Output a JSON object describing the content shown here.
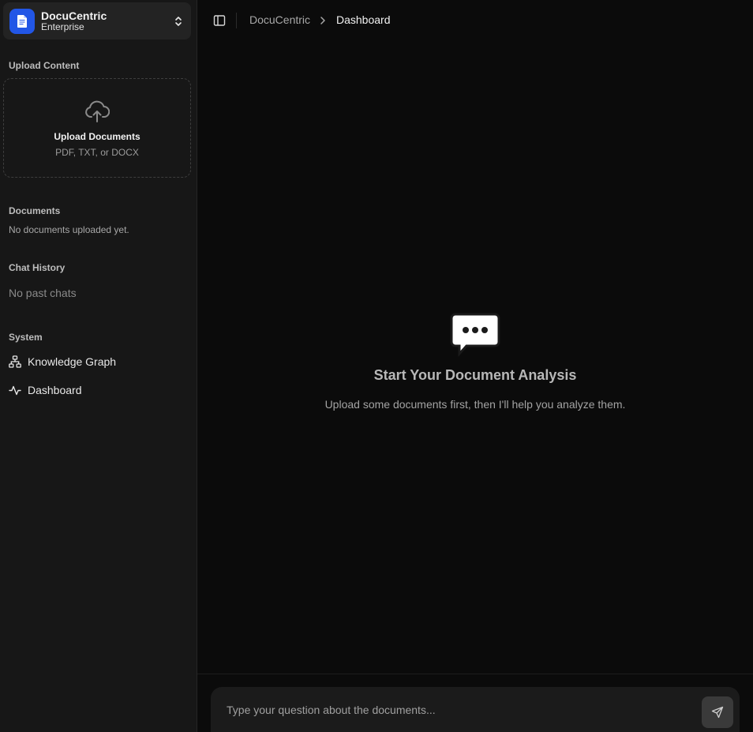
{
  "workspace": {
    "title": "DocuCentric",
    "subtitle": "Enterprise"
  },
  "upload": {
    "section_label": "Upload Content",
    "title": "Upload Documents",
    "subtitle": "PDF, TXT, or DOCX"
  },
  "documents": {
    "section_label": "Documents",
    "empty_text": "No documents uploaded yet."
  },
  "chat_history": {
    "section_label": "Chat History",
    "empty_text": "No past chats"
  },
  "system": {
    "section_label": "System",
    "items": [
      {
        "label": "Knowledge Graph",
        "icon": "network-icon"
      },
      {
        "label": "Dashboard",
        "icon": "activity-icon"
      }
    ]
  },
  "breadcrumb": {
    "root": "DocuCentric",
    "current": "Dashboard"
  },
  "empty_state": {
    "title": "Start Your Document Analysis",
    "subtitle": "Upload some documents first, then I'll help you analyze them."
  },
  "composer": {
    "placeholder": "Type your question about the documents..."
  },
  "colors": {
    "accent": "#2256e6",
    "sidebar_bg": "#171717",
    "main_bg": "#0b0b0b"
  }
}
